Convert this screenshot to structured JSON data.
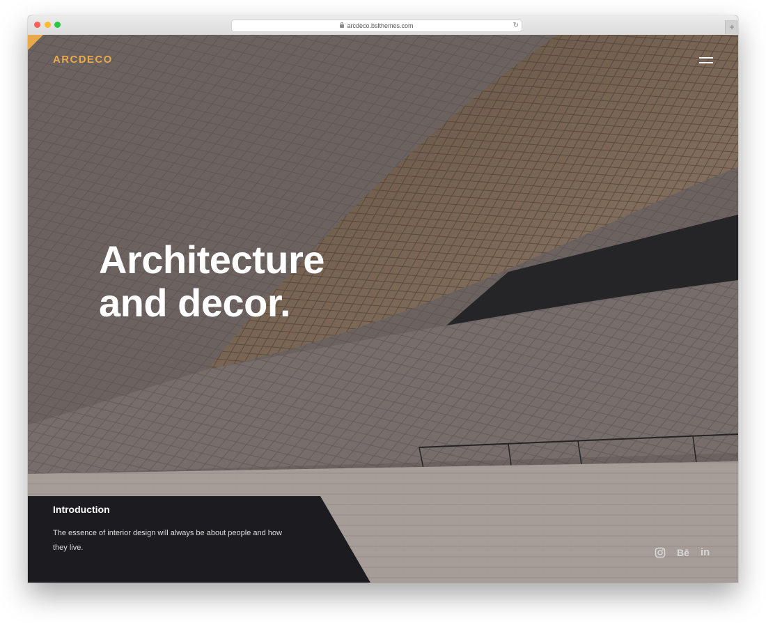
{
  "browser": {
    "url": "arcdeco.bslthemes.com",
    "reload_icon": "reload-icon",
    "new_tab_label": "+"
  },
  "site": {
    "logo": "ARCDECO",
    "menu_icon": "hamburger-menu-icon",
    "headline": "Architecture\nand decor.",
    "accent_color": "#e9a94b",
    "panel_color": "#1c1b1f"
  },
  "intro": {
    "title": "Introduction",
    "text": "The essence of interior design will always be about people and how they live."
  },
  "social": {
    "instagram_icon": "instagram-icon",
    "behance_label": "Bē",
    "linkedin_label": "in"
  }
}
